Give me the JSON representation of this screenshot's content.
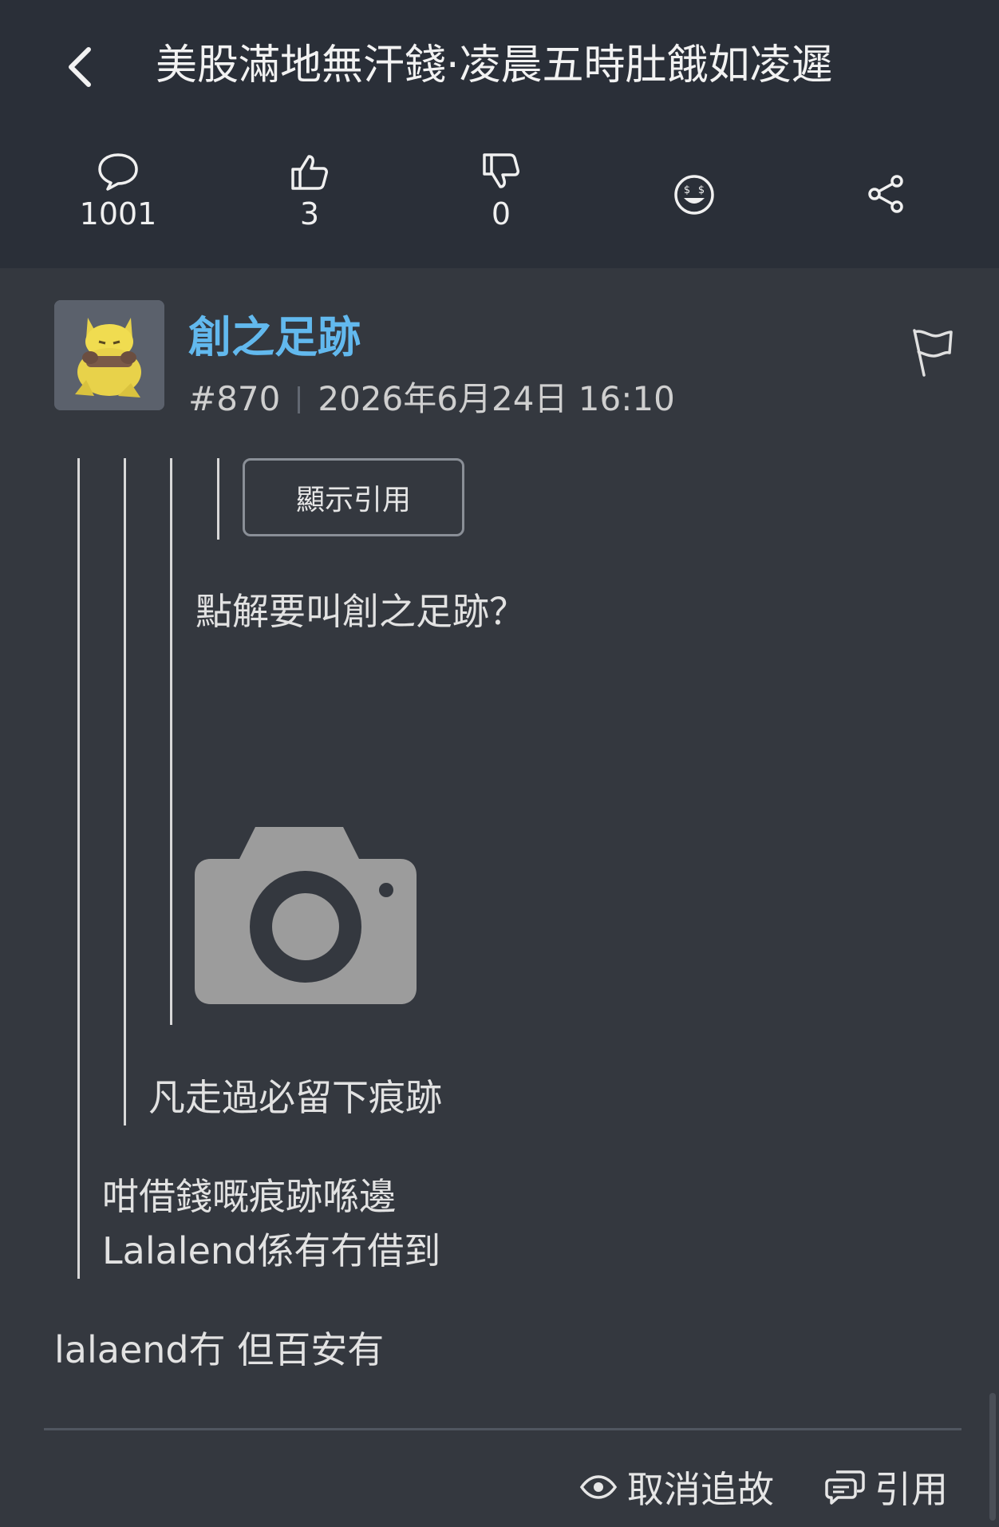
{
  "header": {
    "title": "美股滿地無汗錢·凌晨五時肚餓如凌遲",
    "back_icon": "chevron-left-icon"
  },
  "stats": {
    "comments": "1001",
    "likes": "3",
    "dislikes": "0",
    "reaction_icon": "laughing-money-face-icon",
    "share_icon": "share-icon"
  },
  "post": {
    "author": "創之足跡",
    "number": "#870",
    "datetime": "2026年6月24日 16:10",
    "flag_icon": "flag-icon",
    "show_quote_label": "顯示引用",
    "quote3_text": "點解要叫創之足跡？",
    "quote2_text": "凡走過必留下痕跡",
    "quote1_line1": "咁借錢嘅痕跡喺邊",
    "quote1_line2": "Lalalend係有冇借到",
    "body": "lalaend冇 但百安有"
  },
  "footer": {
    "unfollow_label": "取消追故",
    "quote_label": "引用"
  },
  "colors": {
    "header_bg": "#2a2f38",
    "page_bg": "#34383f",
    "author": "#62b9ee"
  }
}
